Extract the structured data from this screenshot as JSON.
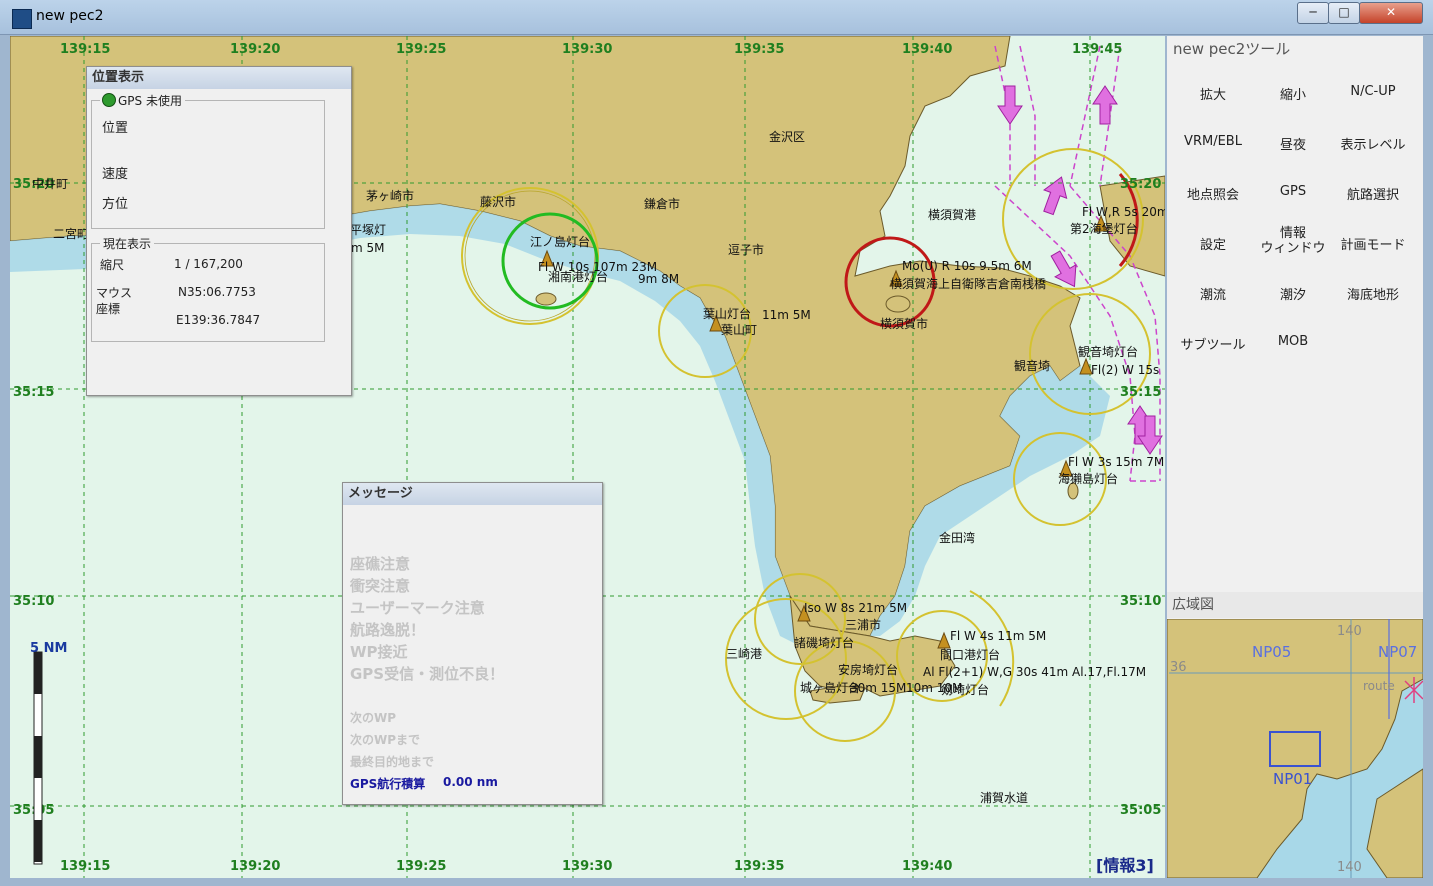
{
  "window": {
    "title": "new pec2",
    "minimize_glyph": "─",
    "maximize_glyph": "□",
    "close_glyph": "✕"
  },
  "map": {
    "lon_labels_top": [
      "139:15",
      "139:20",
      "139:25",
      "139:30",
      "139:35",
      "139:40",
      "139:45"
    ],
    "lon_labels_bottom": [
      "139:15",
      "139:20",
      "139:25",
      "139:30",
      "139:35",
      "139:40"
    ],
    "lat_labels_left": [
      "35:20",
      "35:15",
      "35:10",
      "35:05"
    ],
    "lat_labels_right": [
      "35:20",
      "35:15",
      "35:10",
      "35:05"
    ],
    "scale_label": "5 NM",
    "info_tag": "[情報3]",
    "places": [
      {
        "name": "sign-zushi-nakai",
        "text": "中井町"
      },
      {
        "name": "sign-ninomiya",
        "text": "二宮町"
      },
      {
        "name": "sign-chigasaki",
        "text": "茅ヶ崎市"
      },
      {
        "name": "sign-hiratsuka-light",
        "text": "平塚灯"
      },
      {
        "name": "sign-light-5m",
        "text": "m 5M"
      },
      {
        "name": "sign-fujisawa",
        "text": "藤沢市"
      },
      {
        "name": "sign-kamakura",
        "text": "鎌倉市"
      },
      {
        "name": "sign-kanazawa",
        "text": "金沢区"
      },
      {
        "name": "sign-zushi",
        "text": "逗子市"
      },
      {
        "name": "sign-enoshima-light",
        "text": "江ノ島灯台"
      },
      {
        "name": "sign-enoshima-char",
        "text": "Fl W 10s 107m 23M"
      },
      {
        "name": "sign-shonan-light",
        "text": "湘南港灯台"
      },
      {
        "name": "sign-shonan-char",
        "text": "9m 8M"
      },
      {
        "name": "sign-hayama-light",
        "text": "葉山灯台"
      },
      {
        "name": "sign-hayama-char",
        "text": "11m 5M"
      },
      {
        "name": "sign-hayama",
        "text": "葉山町"
      },
      {
        "name": "sign-yokosuka-port",
        "text": "横須賀港"
      },
      {
        "name": "sign-yokosuka-char",
        "text": "Mo(U) R 10s 9.5m 6M"
      },
      {
        "name": "sign-yokosuka-jmsdf",
        "text": "横須賀海上自衛隊吉倉南桟橋"
      },
      {
        "name": "sign-yokosuka-city",
        "text": "横須賀市"
      },
      {
        "name": "sign-daini-char",
        "text": "Fl W,R 5s 20m"
      },
      {
        "name": "sign-daini-light",
        "text": "第2海堡灯台"
      },
      {
        "name": "sign-kannonzaki-light",
        "text": "観音埼灯台"
      },
      {
        "name": "sign-kannonzaki",
        "text": "観音埼"
      },
      {
        "name": "sign-kannonzaki-char",
        "text": "Fl(2) W 15s"
      },
      {
        "name": "sign-umikashi-char",
        "text": "Fl W 3s 15m 7M"
      },
      {
        "name": "sign-umikashi-light",
        "text": "海獺島灯台"
      },
      {
        "name": "sign-kaneda-bay",
        "text": "金田湾"
      },
      {
        "name": "sign-char-21m",
        "text": "Iso W 8s 21m 5M"
      },
      {
        "name": "sign-miura-city",
        "text": "三浦市"
      },
      {
        "name": "sign-moroiso-light",
        "text": "諸磯埼灯台"
      },
      {
        "name": "sign-misaki-port",
        "text": "三崎港"
      },
      {
        "name": "sign-awa-light",
        "text": "安房埼灯台"
      },
      {
        "name": "sign-jogashima-light",
        "text": "城ヶ島灯台"
      },
      {
        "name": "sign-char-30m",
        "text": "30m 15M"
      },
      {
        "name": "sign-char-10m",
        "text": "10m 10M"
      },
      {
        "name": "sign-tsurugizaki-char1",
        "text": "Fl W 4s 11m 5M"
      },
      {
        "name": "sign-mashiguchi-light",
        "text": "間口港灯台"
      },
      {
        "name": "sign-tsurugizaki-char2",
        "text": "Al Fl(2+1) W,G 30s 41m Al.17,Fl.17M"
      },
      {
        "name": "sign-tsurugizaki-light",
        "text": "剱埼灯台"
      },
      {
        "name": "sign-uraga-channel",
        "text": "浦賀水道"
      }
    ]
  },
  "position_panel": {
    "title": "位置表示",
    "gps_label": "GPS 未使用",
    "gps_status_color": "#2e9a2e",
    "position_label": "位置",
    "speed_label": "速度",
    "heading_label": "方位",
    "current_group": "現在表示",
    "scale_label": "縮尺",
    "scale_value": "1 / 167,200",
    "mouse_coord_label_1": "マウス",
    "mouse_coord_label_2": "座標",
    "lat_value": "N35:06.7753",
    "lon_value": "E139:36.7847"
  },
  "message_panel": {
    "title": "メッセージ",
    "alerts": [
      "座礁注意",
      "衝突注意",
      "ユーザーマーク注意",
      "航路逸脱！",
      "WP接近",
      "GPS受信・測位不良！"
    ],
    "next_wp": "次のWP",
    "to_next_wp": "次のWPまで",
    "to_final": "最終目的地まで",
    "gps_total_label": "GPS航行積算",
    "gps_total_value": "0.00 nm"
  },
  "tools": {
    "title": "new pec2ツール",
    "buttons": [
      [
        "拡大",
        "縮小",
        "N/C-UP"
      ],
      [
        "VRM/EBL",
        "昼夜",
        "表示レベル"
      ],
      [
        "地点照会",
        "GPS",
        "航路選択"
      ],
      [
        "設定",
        "情報\nウィンドウ",
        "計画モード"
      ],
      [
        "潮流",
        "潮汐",
        "海底地形"
      ],
      [
        "サブツール",
        "MOB",
        ""
      ]
    ]
  },
  "overview": {
    "title": "広域図",
    "labels": {
      "lon140a": "140",
      "lon140b": "140",
      "lat36": "36",
      "np05": "NP05",
      "np07": "NP07",
      "np01": "NP01",
      "route": "route"
    }
  },
  "colors": {
    "land": "#d4c27a",
    "sea_shallow": "#a8d8e8",
    "sea_mid": "#c8e8f0",
    "sea_deep": "#e3f5ea",
    "grid": "#2f9a2f",
    "light_ring": "#d4c230",
    "active_ring_green": "#22bb22",
    "active_ring_red": "#c01818",
    "traffic_lane": "#cc44cc"
  }
}
